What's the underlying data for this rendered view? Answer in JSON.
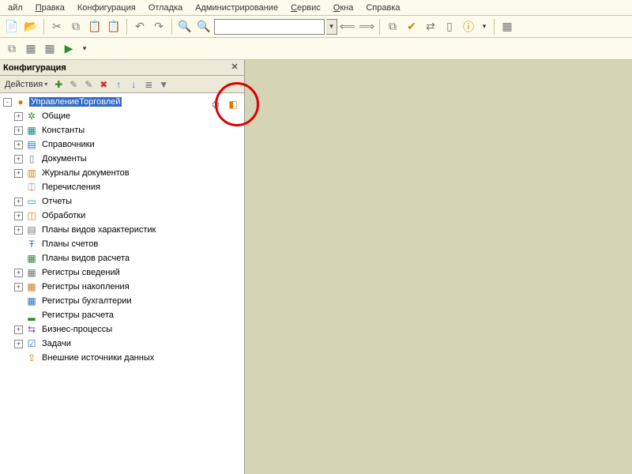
{
  "menu": {
    "items": [
      "айл",
      "Правка",
      "Конфигурация",
      "Отладка",
      "Администрирование",
      "Сервис",
      "Окна",
      "Справка"
    ]
  },
  "toolbar": {
    "search_value": "",
    "search_placeholder": ""
  },
  "panel": {
    "title": "Конфигурация",
    "actions_label": "Действия",
    "close_glyph": "✕"
  },
  "tree": {
    "root": {
      "label": "УправлениеТорговлей",
      "icon": "●",
      "icon_class": "c-orange",
      "selected": true,
      "exp": "-"
    },
    "children": [
      {
        "label": "Общие",
        "icon": "✲",
        "icon_class": "c-green",
        "exp": "+"
      },
      {
        "label": "Константы",
        "icon": "▦",
        "icon_class": "c-teal",
        "exp": "+"
      },
      {
        "label": "Справочники",
        "icon": "▤",
        "icon_class": "c-blue",
        "exp": "+"
      },
      {
        "label": "Документы",
        "icon": "▯",
        "icon_class": "c-grey",
        "exp": "+"
      },
      {
        "label": "Журналы документов",
        "icon": "▥",
        "icon_class": "c-orange",
        "exp": "+"
      },
      {
        "label": "Перечисления",
        "icon": "⎅",
        "icon_class": "c-grey",
        "exp": ""
      },
      {
        "label": "Отчеты",
        "icon": "▭",
        "icon_class": "c-cyan",
        "exp": "+"
      },
      {
        "label": "Обработки",
        "icon": "◫",
        "icon_class": "c-orange",
        "exp": "+"
      },
      {
        "label": "Планы видов характеристик",
        "icon": "▤",
        "icon_class": "c-grey",
        "exp": "+"
      },
      {
        "label": "Планы счетов",
        "icon": "Ŧ",
        "icon_class": "c-blue",
        "exp": ""
      },
      {
        "label": "Планы видов расчета",
        "icon": "▦",
        "icon_class": "c-green",
        "exp": ""
      },
      {
        "label": "Регистры сведений",
        "icon": "▦",
        "icon_class": "c-grey",
        "exp": "+"
      },
      {
        "label": "Регистры накопления",
        "icon": "▦",
        "icon_class": "c-orange",
        "exp": "+"
      },
      {
        "label": "Регистры бухгалтерии",
        "icon": "▦",
        "icon_class": "c-blue",
        "exp": ""
      },
      {
        "label": "Регистры расчета",
        "icon": "▂",
        "icon_class": "c-green",
        "exp": ""
      },
      {
        "label": "Бизнес-процессы",
        "icon": "⇆",
        "icon_class": "c-purple",
        "exp": "+"
      },
      {
        "label": "Задачи",
        "icon": "☑",
        "icon_class": "c-blue",
        "exp": "+"
      },
      {
        "label": "Внешние источники данных",
        "icon": "⇪",
        "icon_class": "c-orange",
        "exp": ""
      }
    ]
  },
  "corner_icons": {
    "db_icon": "⛭",
    "cube_icon": "◧"
  }
}
